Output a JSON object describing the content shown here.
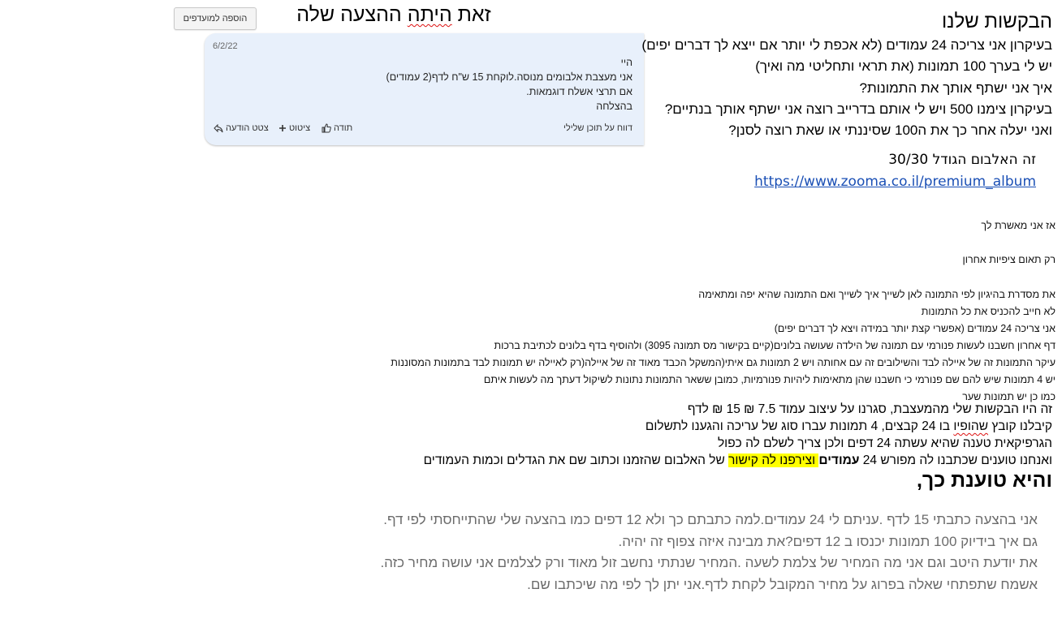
{
  "offer_title": {
    "before": "זאת ",
    "squiggle": "היתה",
    "after": " ההצעה שלה"
  },
  "favorites_button": "הוספה למועדפים",
  "message_card": {
    "date": "6/2/22",
    "lines": [
      "היי",
      "אני מעצבת אלבומים מנוסה.לוקחת 15 ש\"ח לדף(2 עמודים)",
      "אם תרצי אשלח דוגמאות.",
      "בהצלחה"
    ],
    "report_label": "דווח על תוכן שלילי",
    "actions": {
      "thanks": "תודה",
      "quote": "ציטוט",
      "quote_message": "צטט הודעה"
    }
  },
  "requests": {
    "heading": "הבקשות שלנו",
    "items": [
      "בעיקרון אני צריכה 24 עמודים (לא אכפת לי יותר אם ייצא לך דברים יפים)",
      "יש לי בערך 100 תמונות (את תראי ותחליטי מה ואיך)",
      "איך אני ישתף אותך את התמונות?",
      "בעיקרון צימנו 500 ויש לי אותם בדרייב רוצה אני ישתף אותך בנתיים?",
      "ואני יעלה אחר כך את ה100 שסיננתי או שאת רוצה לסנן?"
    ],
    "album_size": "זה האלבום הגודל 30/30",
    "album_link": "https://www.zooma.co.il/premium_album"
  },
  "chat": {
    "approve": "אז אני מאשרת לך",
    "coordinate": "רק תאום ציפיות אחרון",
    "lines": [
      "את מסדרת בהיגיון לפי התמונה לאן לשייך איך לשייך ואם התמונה שהיא יפה ומתאימה",
      "לא חייב להכניס את כל התמונות",
      "אני צריכה 24 עמודים (אפשרי קצת יותר במידה ויצא לך דברים יפים)",
      "דף אחרון חשבנו לעשות פנורמי עם תמונה של הילדה שעושה בלונים(קיים בקישור מס תמונה 3095) ולהוסיף בדף בלונים לכתיבת ברכות",
      "עיקר התמונות זה של איילה לבד והשילובים זה עם אחותה  ויש 2 תמונות גם איתי(המשקל הכבד מאוד זה של איילה(רק לאיילה יש תמונות לבד בתמונות המסוננות",
      "יש 4 תמונות שיש להם שם פנורמי כי חשבנו שהן מתאימות ליהיות פנורמיות, כמובן ששאר התמונות נתונות לשיקול דעתך מה לעשות איתם",
      "כמו כן יש תמונות שער"
    ]
  },
  "summary": {
    "line1": "זה היו הבקשות שלי מהמעצבת, סגרנו על עיצוב עמוד 7.5 ₪ 15 ₪ לדף",
    "line2_before": "קיבלנו קובץ ",
    "line2_squiggle": "שהופיו",
    "line2_after": " בו 24 קבצים, 4 תמונות עברו סוג של עריכה והגענו לתשלום",
    "line3": "הגרפיקאית טענה שהיא עשתה 24 דפים ולכן צריך לשלם לה כפול",
    "line4_before": "ואנחנו טוענים שכתבנו לה מפורש 24 ",
    "line4_bold": "עמודים",
    "line4_highlight": " וצירפנו לה קישור",
    "line4_after": " של האלבום שהזמנו וכתוב שם את הגדלים וכמות העמודים"
  },
  "claim_heading": "והיא טוענת כך,",
  "response": {
    "lines": [
      "אני בהצעה כתבתי 15 לדף .עניתם לי 24 עמודים.למה כתבתם כך ולא 12 דפים כמו בהצעה שלי שהתייחסתי לפי דף.",
      "גם איך בידיוק 100 תמונות יכנסו ב 12 דפים?את מבינה איזה צפוף זה יהיה.",
      "את יודעת היטב וגם אני מה המחיר של צלמת לשעה .המחיר שנתתי נחשב זול מאוד ורק לצלמים אני עושה מחיר כזה.",
      "אשמח שתפתחי שאלה בפרוג על מחיר המקובל לקחת לדף.אני יתן לך לפי מה שיכתבו שם."
    ]
  }
}
